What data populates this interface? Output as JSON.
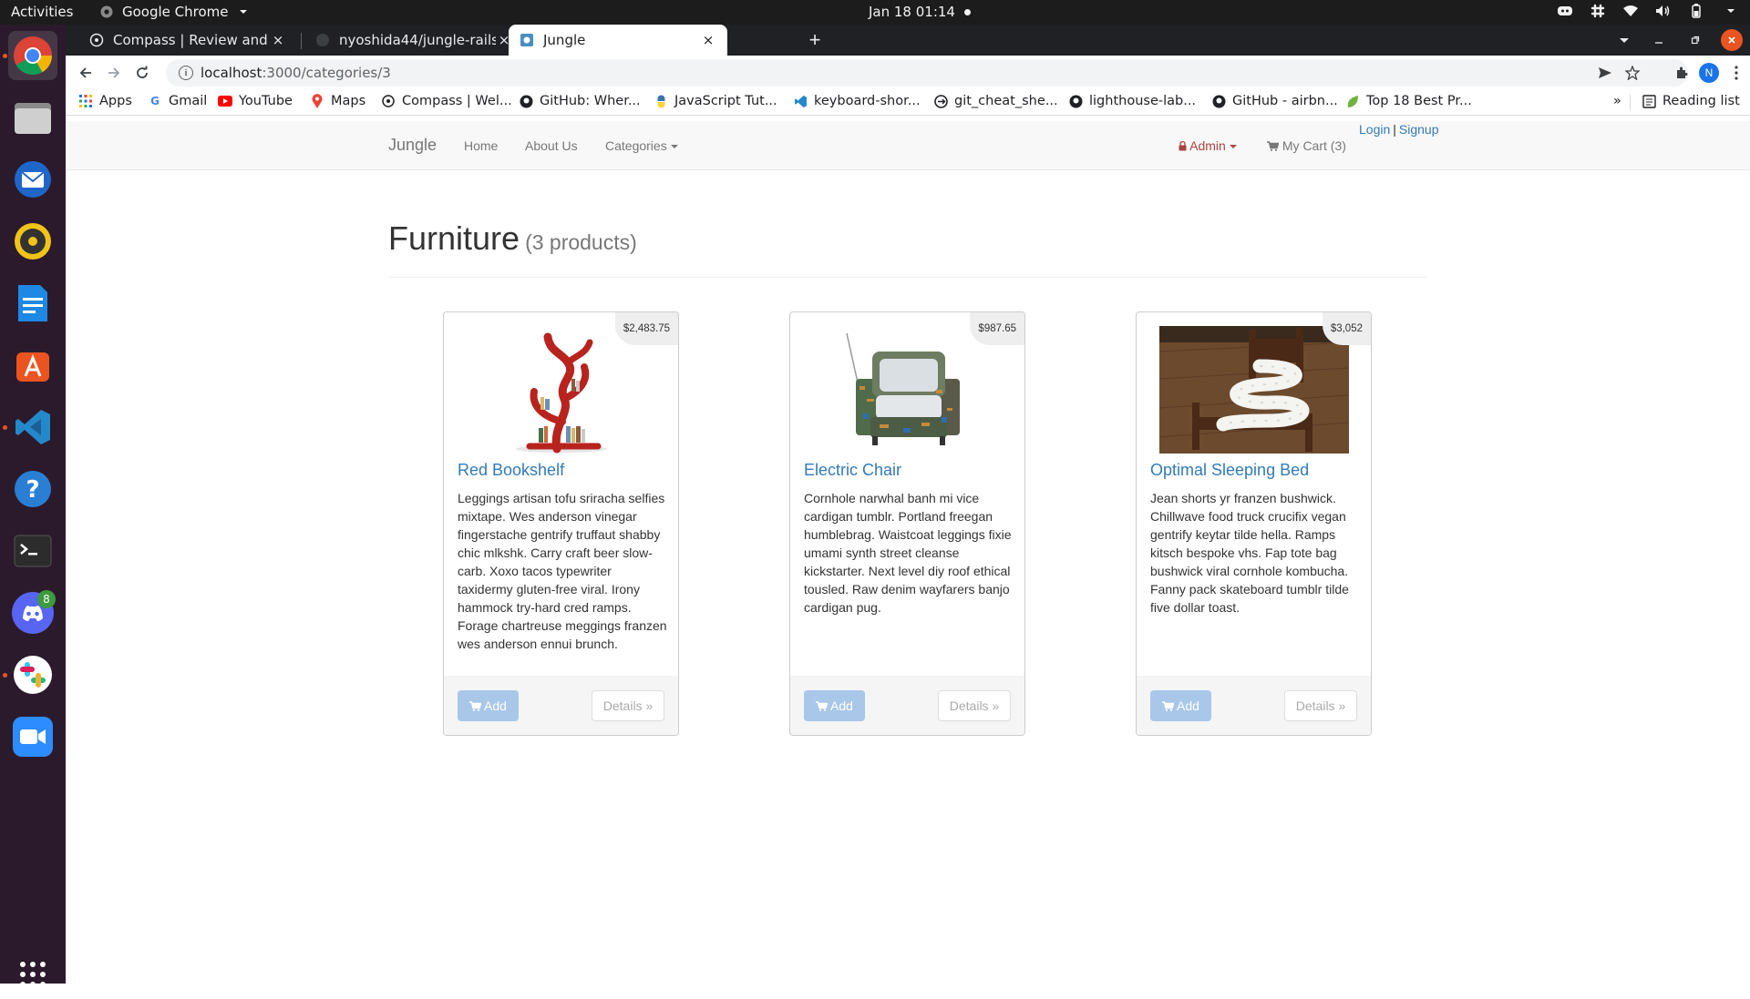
{
  "system": {
    "activities": "Activities",
    "app_name": "Google Chrome",
    "clock": "Jan 18  01:14"
  },
  "dock": {
    "apps": [
      "chrome",
      "files",
      "thunderbird",
      "rhythmbox",
      "writer",
      "software",
      "vscode",
      "help",
      "terminal",
      "discord",
      "slack",
      "zoom",
      "app-grid"
    ],
    "discord_badge": "8"
  },
  "browser": {
    "tabs": [
      {
        "title": "Compass | Review and Sub",
        "close": "×"
      },
      {
        "title": "nyoshida44/jungle-rails",
        "close": "×"
      },
      {
        "title": "Jungle",
        "close": "×"
      }
    ],
    "new_tab": "+",
    "url_host": "localhost",
    "url_path": ":3000/categories/3",
    "profile_initial": "N",
    "bookmarks": [
      {
        "label": "Apps",
        "icon": "apps-grid-icon"
      },
      {
        "label": "Gmail",
        "icon": "google-icon"
      },
      {
        "label": "YouTube",
        "icon": "youtube-icon"
      },
      {
        "label": "Maps",
        "icon": "maps-icon"
      },
      {
        "label": "Compass | Wel...",
        "icon": "compass-icon"
      },
      {
        "label": "GitHub: Wher...",
        "icon": "github-icon"
      },
      {
        "label": "JavaScript Tut...",
        "icon": "python-icon"
      },
      {
        "label": "keyboard-shor...",
        "icon": "vscode-icon"
      },
      {
        "label": "git_cheat_she...",
        "icon": "git-icon"
      },
      {
        "label": "lighthouse-lab...",
        "icon": "github-icon"
      },
      {
        "label": "GitHub - airbn...",
        "icon": "github-icon"
      },
      {
        "label": "Top 18 Best Pr...",
        "icon": "leaf-icon"
      }
    ],
    "bookmarks_overflow": "»",
    "reading_list": "Reading list"
  },
  "site": {
    "brand": "Jungle",
    "nav": {
      "home": "Home",
      "about": "About Us",
      "categories": "Categories"
    },
    "admin": "Admin",
    "cart": "My Cart (3)",
    "login": "Login",
    "signup": "Signup",
    "auth_sep": "|"
  },
  "category": {
    "title": "Furniture",
    "count": "(3 products)"
  },
  "products": [
    {
      "name": "Red Bookshelf",
      "price": "$2,483.75",
      "description": "Leggings artisan tofu sriracha selfies mixtape. Wes anderson vinegar fingerstache gentrify truffaut shabby chic mlkshk. Carry craft beer slow-carb. Xoxo tacos typewriter taxidermy gluten-free viral. Irony hammock try-hard cred ramps. Forage chartreuse meggings franzen wes anderson ennui brunch.",
      "add": "Add",
      "details": "Details »"
    },
    {
      "name": "Electric Chair",
      "price": "$987.65",
      "description": "Cornhole narwhal banh mi vice cardigan tumblr. Portland freegan humblebrag. Waistcoat leggings fixie umami synth street cleanse kickstarter. Next level diy roof ethical tousled. Raw denim wayfarers banjo cardigan pug.",
      "add": "Add",
      "details": "Details »"
    },
    {
      "name": "Optimal Sleeping Bed",
      "price": "$3,052",
      "description": "Jean shorts yr franzen bushwick. Chillwave food truck crucifix vegan gentrify keytar tilde hella. Ramps kitsch bespoke vhs. Fap tote bag bushwick viral cornhole kombucha. Fanny pack skateboard tumblr tilde five dollar toast.",
      "add": "Add",
      "details": "Details »"
    }
  ],
  "colors": {
    "link": "#337ab7",
    "admin": "#a94442",
    "ubuntu_orange": "#e95420"
  }
}
